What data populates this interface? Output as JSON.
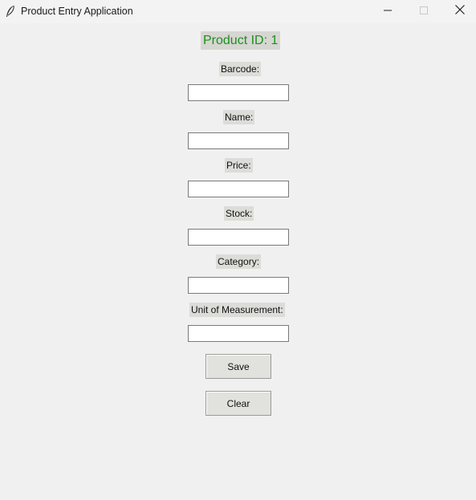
{
  "window": {
    "title": "Product Entry Application",
    "icon": "feather-icon",
    "controls": [
      "minimize-icon",
      "maximize-icon",
      "close-icon"
    ]
  },
  "form": {
    "product_id_label": "Product ID: 1",
    "product_id_color": "#1f8f1f",
    "fields": {
      "barcode": {
        "label": "Barcode:",
        "value": ""
      },
      "name": {
        "label": "Name:",
        "value": ""
      },
      "price": {
        "label": "Price:",
        "value": ""
      },
      "stock": {
        "label": "Stock:",
        "value": ""
      },
      "category": {
        "label": "Category:",
        "value": ""
      },
      "unit": {
        "label": "Unit of Measurement:",
        "value": ""
      }
    },
    "buttons": {
      "save": "Save",
      "clear": "Clear"
    }
  }
}
